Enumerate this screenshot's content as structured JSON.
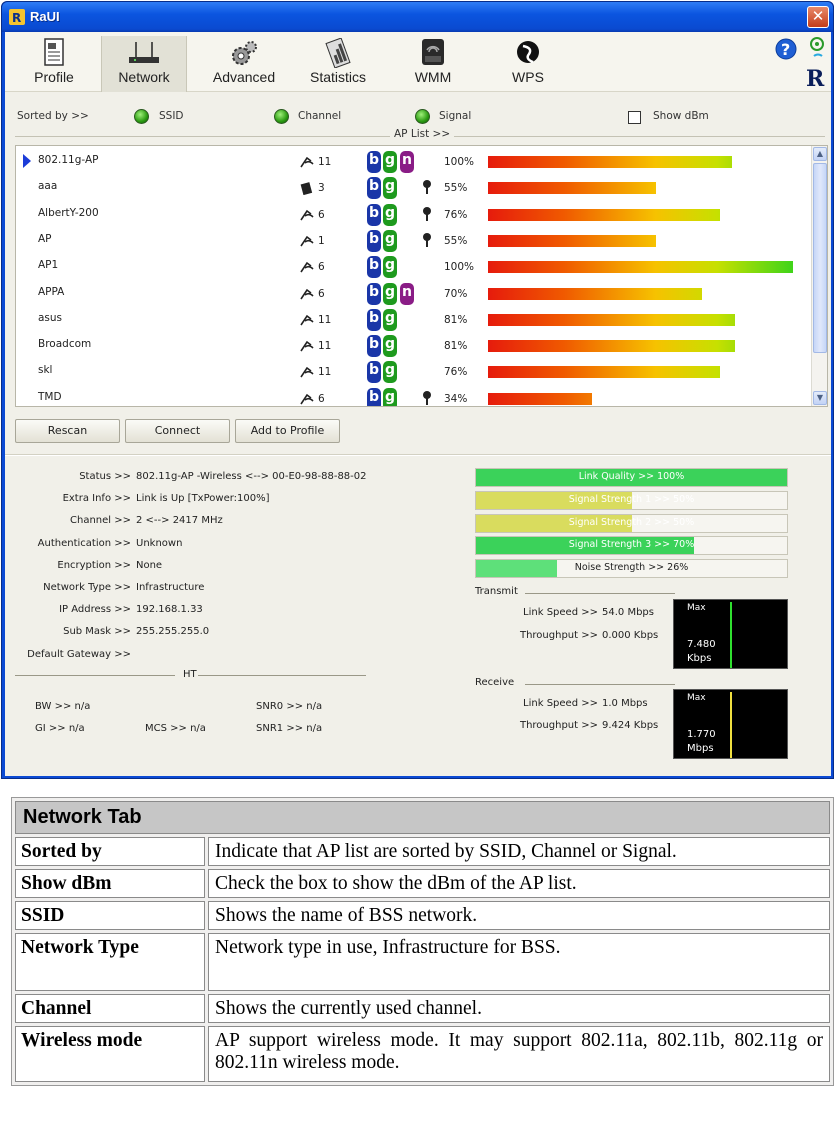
{
  "window": {
    "title": "RaUI",
    "close_label": "✕"
  },
  "toolbar": {
    "tabs": [
      {
        "label": "Profile"
      },
      {
        "label": "Network"
      },
      {
        "label": "Advanced"
      },
      {
        "label": "Statistics"
      },
      {
        "label": "WMM"
      },
      {
        "label": "WPS"
      }
    ],
    "active_tab": "Network"
  },
  "sort": {
    "label": "Sorted by >>",
    "options": [
      "SSID",
      "Channel",
      "Signal"
    ],
    "show_dbm_label": "Show dBm",
    "show_dbm_checked": false,
    "ap_list_caption": "AP List >>"
  },
  "ap_list": [
    {
      "ssid": "802.11g-AP",
      "channel": "11",
      "modes": [
        "b",
        "g",
        "n"
      ],
      "secured": false,
      "signal_text": "100%",
      "signal": 80,
      "selected": true
    },
    {
      "ssid": "aaa",
      "channel": "3",
      "modes": [
        "b",
        "g"
      ],
      "secured": true,
      "signal_text": "55%",
      "signal": 55,
      "selected": false
    },
    {
      "ssid": "AlbertY-200",
      "channel": "6",
      "modes": [
        "b",
        "g"
      ],
      "secured": true,
      "signal_text": "76%",
      "signal": 76,
      "selected": false
    },
    {
      "ssid": "AP",
      "channel": "1",
      "modes": [
        "b",
        "g"
      ],
      "secured": true,
      "signal_text": "55%",
      "signal": 55,
      "selected": false
    },
    {
      "ssid": "AP1",
      "channel": "6",
      "modes": [
        "b",
        "g"
      ],
      "secured": false,
      "signal_text": "100%",
      "signal": 100,
      "selected": false
    },
    {
      "ssid": "APPA",
      "channel": "6",
      "modes": [
        "b",
        "g",
        "n"
      ],
      "secured": false,
      "signal_text": "70%",
      "signal": 70,
      "selected": false
    },
    {
      "ssid": "asus",
      "channel": "11",
      "modes": [
        "b",
        "g"
      ],
      "secured": false,
      "signal_text": "81%",
      "signal": 81,
      "selected": false
    },
    {
      "ssid": "Broadcom",
      "channel": "11",
      "modes": [
        "b",
        "g"
      ],
      "secured": false,
      "signal_text": "81%",
      "signal": 81,
      "selected": false
    },
    {
      "ssid": "skl",
      "channel": "11",
      "modes": [
        "b",
        "g"
      ],
      "secured": false,
      "signal_text": "76%",
      "signal": 76,
      "selected": false
    },
    {
      "ssid": "TMD",
      "channel": "6",
      "modes": [
        "b",
        "g"
      ],
      "secured": true,
      "signal_text": "34%",
      "signal": 34,
      "selected": false
    }
  ],
  "buttons": {
    "rescan": "Rescan",
    "connect": "Connect",
    "add_to_profile": "Add to Profile"
  },
  "status": {
    "rows": [
      {
        "label": "Status >>",
        "value": "802.11g-AP -Wireless <--> 00-E0-98-88-88-02"
      },
      {
        "label": "Extra Info >>",
        "value": "Link is Up [TxPower:100%]"
      },
      {
        "label": "Channel >>",
        "value": "2 <--> 2417 MHz"
      },
      {
        "label": "Authentication >>",
        "value": "Unknown"
      },
      {
        "label": "Encryption >>",
        "value": "None"
      },
      {
        "label": "Network Type >>",
        "value": "Infrastructure"
      },
      {
        "label": "IP Address >>",
        "value": "192.168.1.33"
      },
      {
        "label": "Sub Mask >>",
        "value": "255.255.255.0"
      },
      {
        "label": "Default Gateway >>",
        "value": ""
      }
    ],
    "ht_label": "HT",
    "ht": {
      "bw": "BW >> n/a",
      "gi": "GI >> n/a",
      "mcs": "MCS >> n/a",
      "snr0": "SNR0 >> n/a",
      "snr1": "SNR1 >> n/a"
    }
  },
  "meters": [
    {
      "text": "Link Quality >> 100%",
      "level": 100,
      "color": "#3bd25a"
    },
    {
      "text": "Signal Strength 1 >> 50%",
      "level": 50,
      "color": "#d9dc5e"
    },
    {
      "text": "Signal Strength 2 >> 50%",
      "level": 50,
      "color": "#d9dc5e"
    },
    {
      "text": "Signal Strength 3 >> 70%",
      "level": 70,
      "color": "#3bd25a"
    },
    {
      "text": "Noise Strength >> 26%",
      "level": 26,
      "color": "#5ee07a"
    }
  ],
  "transmit": {
    "label": "Transmit",
    "link_speed_label": "Link Speed >>",
    "link_speed": "54.0 Mbps",
    "throughput_label": "Throughput >>",
    "throughput": "0.000 Kbps",
    "graph_max": "Max",
    "graph_value": "7.480",
    "graph_unit": "Kbps",
    "graph_color": "#2fe02f"
  },
  "receive": {
    "label": "Receive",
    "link_speed_label": "Link Speed >>",
    "link_speed": "1.0 Mbps",
    "throughput_label": "Throughput >>",
    "throughput": "9.424 Kbps",
    "graph_max": "Max",
    "graph_value": "1.770",
    "graph_unit": "Mbps",
    "graph_color": "#f0e040"
  },
  "doc_table": {
    "title": "Network Tab",
    "rows": [
      {
        "term": "Sorted by",
        "desc": "Indicate that AP list are sorted by SSID, Channel or Signal."
      },
      {
        "term": "Show dBm",
        "desc": "Check the box to show the dBm of the AP list."
      },
      {
        "term": "SSID",
        "desc": "Shows the name of BSS network."
      },
      {
        "term": "Network Type",
        "desc": "Network type in use, Infrastructure for BSS."
      },
      {
        "term": "Channel",
        "desc": "Shows the currently used channel."
      },
      {
        "term": "Wireless mode",
        "desc": "AP support wireless mode. It may support 802.11a, 802.11b, 802.11g or 802.11n wireless mode."
      }
    ]
  }
}
